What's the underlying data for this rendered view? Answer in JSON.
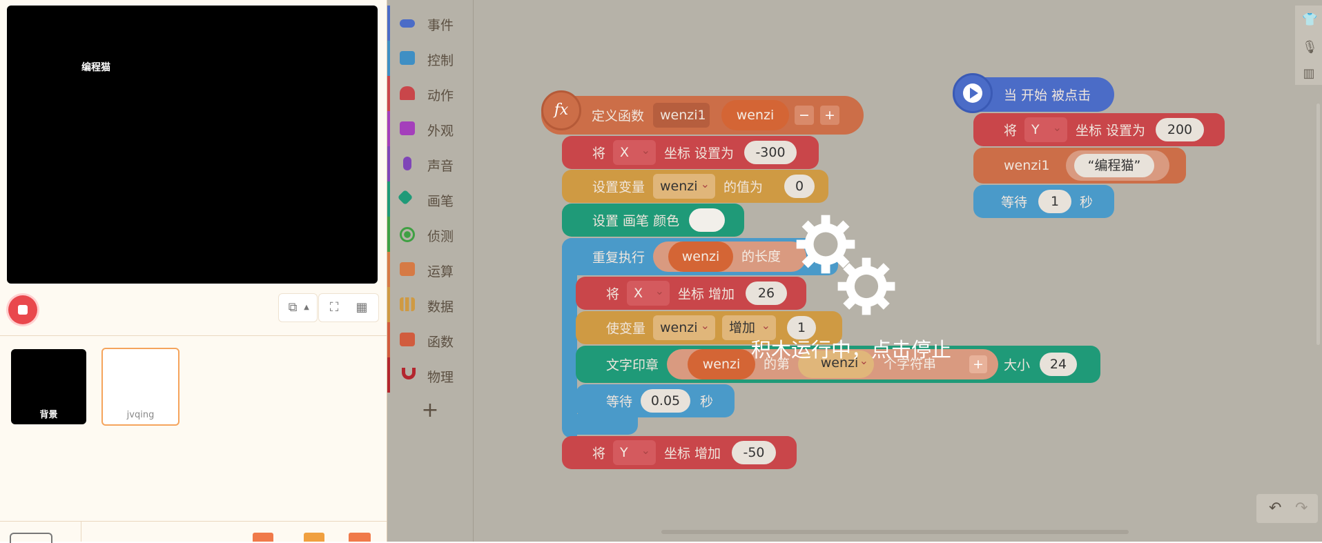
{
  "stage": {
    "text": "编程猫"
  },
  "sprites": [
    {
      "label": "背景"
    },
    {
      "label": "jvqing"
    }
  ],
  "categories": [
    {
      "label": "事件",
      "color": "#4b6cc7",
      "icon": "toggle-icon"
    },
    {
      "label": "控制",
      "color": "#3f8fc4",
      "icon": "gamepad-icon"
    },
    {
      "label": "动作",
      "color": "#c9464a",
      "icon": "ghost-icon"
    },
    {
      "label": "外观",
      "color": "#a43fbb",
      "icon": "shirt-icon"
    },
    {
      "label": "声音",
      "color": "#7f45b8",
      "icon": "mic-icon"
    },
    {
      "label": "画笔",
      "color": "#1f9a78",
      "icon": "pen-icon"
    },
    {
      "label": "侦测",
      "color": "#3fa043",
      "icon": "radar-icon"
    },
    {
      "label": "运算",
      "color": "#d67a45",
      "icon": "calc-icon"
    },
    {
      "label": "数据",
      "color": "#cf9a43",
      "icon": "bar-chart-icon"
    },
    {
      "label": "函数",
      "color": "#d15c3e",
      "icon": "function-icon"
    },
    {
      "label": "物理",
      "color": "#b3262e",
      "icon": "magnet-icon"
    }
  ],
  "add_category": "+",
  "blocks": {
    "define": {
      "label": "定义函数",
      "fname": "wenzi1",
      "param": "wenzi",
      "minus": "−",
      "plus": "+",
      "fx": "fx"
    },
    "setx": {
      "pre": "将",
      "axis": "X",
      "mid": "坐标 设置为",
      "val": "-300"
    },
    "setvar": {
      "pre": "设置变量",
      "var": "wenzi",
      "mid": "的值为",
      "val": "0"
    },
    "pencolor": {
      "label": "设置 画笔 颜色"
    },
    "repeat": {
      "label": "重复执行",
      "var": "wenzi",
      "mid": "的长度",
      "suffix": "次"
    },
    "changex": {
      "pre": "将",
      "axis": "X",
      "mid": "坐标 增加",
      "val": "26"
    },
    "changevar": {
      "pre": "使变量",
      "var": "wenzi",
      "op": "增加",
      "val": "1"
    },
    "stamp": {
      "label": "文字印章",
      "var": "wenzi",
      "mid1": "的第",
      "var2": "wenzi",
      "mid2": "个字符串",
      "plus": "+",
      "size_label": "大小",
      "size": "24"
    },
    "wait1": {
      "label": "等待",
      "val": "0.05",
      "unit": "秒"
    },
    "changey": {
      "pre": "将",
      "axis": "Y",
      "mid": "坐标 增加",
      "val": "-50"
    },
    "hat": {
      "label": "当 开始 被点击"
    },
    "sety": {
      "pre": "将",
      "axis": "Y",
      "mid": "坐标 设置为",
      "val": "200"
    },
    "call": {
      "fname": "wenzi1",
      "arg": "“编程猫”"
    },
    "wait2": {
      "label": "等待",
      "val": "1",
      "unit": "秒"
    }
  },
  "overlay": {
    "text": "积木运行中，点击停止"
  },
  "colors": {
    "stage_bg": "#000000",
    "workspace_bg": "#b6b2a8",
    "accent": "#f5a45c"
  }
}
